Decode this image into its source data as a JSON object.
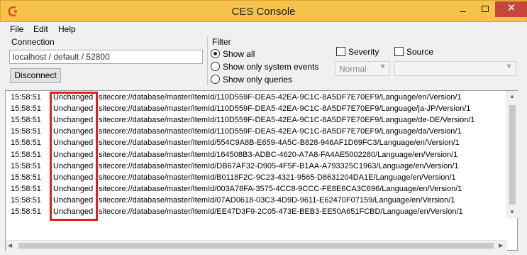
{
  "window": {
    "title": "CES Console",
    "icon": "ces-app-icon"
  },
  "menu": [
    "File",
    "Edit",
    "Help"
  ],
  "connection": {
    "label": "Connection",
    "value": "localhost / default / 52800",
    "disconnect_label": "Disconnect"
  },
  "filter": {
    "label": "Filter",
    "options": [
      "Show all",
      "Show only system events",
      "Show only queries"
    ],
    "selected_option": "Show all",
    "severity": {
      "label": "Severity",
      "checked": false,
      "value": "Normal"
    },
    "source": {
      "label": "Source",
      "checked": false,
      "value": ""
    }
  },
  "log": {
    "rows": [
      {
        "time": "15:58:51",
        "status": "Unchanged",
        "uri": "sitecore://database/master/ItemId/110D559F-DEA5-42EA-9C1C-8A5DF7E70EF9/Language/en/Version/1"
      },
      {
        "time": "15:58:51",
        "status": "Unchanged",
        "uri": "sitecore://database/master/ItemId/110D559F-DEA5-42EA-9C1C-8A5DF7E70EF9/Language/ja-JP/Version/1"
      },
      {
        "time": "15:58:51",
        "status": "Unchanged",
        "uri": "sitecore://database/master/ItemId/110D559F-DEA5-42EA-9C1C-8A5DF7E70EF9/Language/de-DE/Version/1"
      },
      {
        "time": "15:58:51",
        "status": "Unchanged",
        "uri": "sitecore://database/master/ItemId/110D559F-DEA5-42EA-9C1C-8A5DF7E70EF9/Language/da/Version/1"
      },
      {
        "time": "15:58:51",
        "status": "Unchanged",
        "uri": "sitecore://database/master/ItemId/554C9A8B-E659-4A5C-B828-946AF1D69FC3/Language/en/Version/1"
      },
      {
        "time": "15:58:51",
        "status": "Unchanged",
        "uri": "sitecore://database/master/ItemId/164508B3-ADBC-4620-A7A8-FA4AE5002280/Language/en/Version/1"
      },
      {
        "time": "15:58:51",
        "status": "Unchanged",
        "uri": "sitecore://database/master/ItemId/DB67AF32-D905-4F5F-B1AA-A793325C1963/Language/en/Version/1"
      },
      {
        "time": "15:58:51",
        "status": "Unchanged",
        "uri": "sitecore://database/master/ItemId/B0118F2C-9C23-4321-9565-D8631204DA1E/Language/en/Version/1"
      },
      {
        "time": "15:58:51",
        "status": "Unchanged",
        "uri": "sitecore://database/master/ItemId/003A78FA-3575-4CC8-9CCC-FE8E6CA3C696/Language/en/Version/1"
      },
      {
        "time": "15:58:51",
        "status": "Unchanged",
        "uri": "sitecore://database/master/ItemId/07AD0618-03C3-4D9D-9611-E62470F07159/Language/en/Version/1"
      },
      {
        "time": "15:58:51",
        "status": "Unchanged",
        "uri": "sitecore://database/master/ItemId/EE47D3F9-2C05-473E-BEB3-EE50A651FCBD/Language/en/Version/1"
      }
    ]
  },
  "colors": {
    "titlebar": "#f5c24a",
    "close": "#c7463a",
    "highlight": "#e0211b"
  }
}
